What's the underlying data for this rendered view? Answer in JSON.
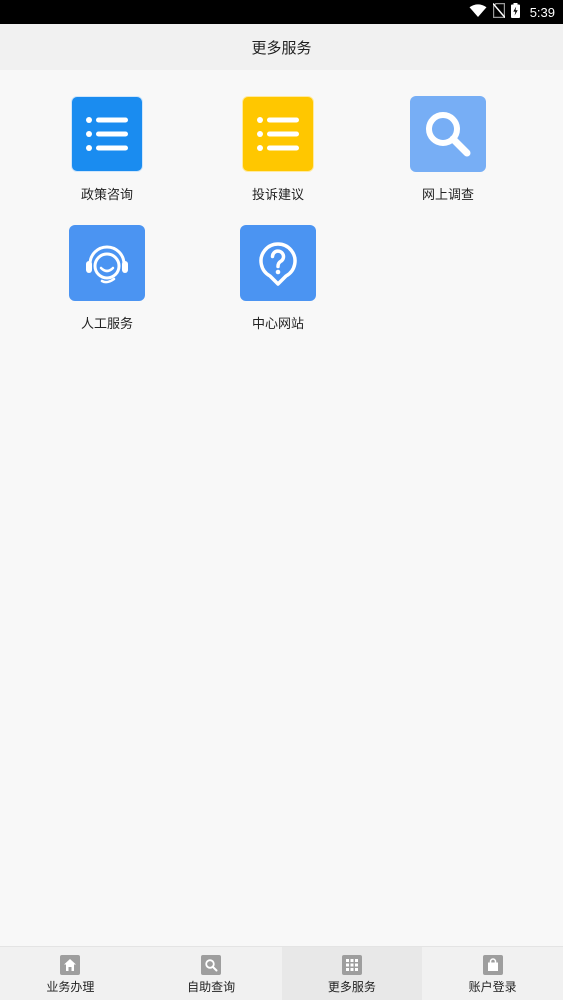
{
  "status_bar": {
    "time": "5:39",
    "icons": [
      "wifi-icon",
      "no-sim-icon",
      "battery-charging-icon"
    ]
  },
  "header": {
    "title": "更多服务"
  },
  "services": [
    {
      "label": "政策咨询",
      "icon": "list-icon",
      "color": "#1a8cf0"
    },
    {
      "label": "投诉建议",
      "icon": "list-icon",
      "color": "#ffc700"
    },
    {
      "label": "网上调查",
      "icon": "search-icon",
      "color": "#77aef5"
    },
    {
      "label": "人工服务",
      "icon": "headset-icon",
      "color": "#4b94f2"
    },
    {
      "label": "中心网站",
      "icon": "help-icon",
      "color": "#4b94f2"
    }
  ],
  "bottom_nav": {
    "active_index": 2,
    "items": [
      {
        "label": "业务办理",
        "icon": "home-icon"
      },
      {
        "label": "自助查询",
        "icon": "search-icon"
      },
      {
        "label": "更多服务",
        "icon": "grid-icon"
      },
      {
        "label": "账户登录",
        "icon": "bag-icon"
      }
    ]
  },
  "colors": {
    "status_bar_bg": "#000000",
    "header_bg": "#f1f1f1",
    "content_bg": "#f8f8f8",
    "nav_icon": "#9e9e9e",
    "text": "#222222"
  }
}
